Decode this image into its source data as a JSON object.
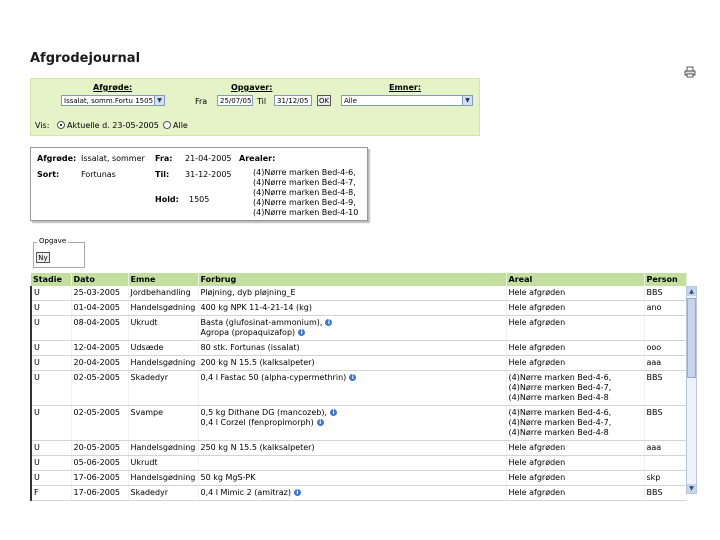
{
  "page": {
    "title": "Afgrodejournal"
  },
  "filter": {
    "afgrode_label": "Afgrøde:",
    "afgrode_value": "Issalat, somm.Fortu 1505",
    "opgaver_label": "Opgaver:",
    "fra_label": "Fra",
    "fra_value": "25/07/05",
    "til_label": "Til",
    "til_value": "31/12/05",
    "ok_label": "OK",
    "emner_label": "Emner:",
    "emner_value": "Alle",
    "vis_label": "Vis:",
    "vis_opt1": "Aktuelle d. 23-05-2005",
    "vis_opt2": "Alle"
  },
  "info": {
    "afgrode_label": "Afgrøde:",
    "afgrode_value": "Issalat, sommer",
    "fra_label": "Fra:",
    "fra_value": "21-04-2005",
    "areal_label": "Arealer:",
    "sort_label": "Sort:",
    "sort_value": "Fortunas",
    "til_label": "Til:",
    "til_value": "31-12-2005",
    "hold_label": "Hold:",
    "hold_value": "1505",
    "areas": [
      "(4)Nørre marken Bed-4-6,",
      "(4)Nørre marken Bed-4-7,",
      "(4)Nørre marken Bed-4-8,",
      "(4)Nørre marken Bed-4-9,",
      "(4)Nørre marken Bed-4-10"
    ]
  },
  "opgave": {
    "legend": "Opgave",
    "button": "Ny"
  },
  "table": {
    "headers": [
      "Stadie",
      "Dato",
      "Emne",
      "Forbrug",
      "Areal",
      "Person"
    ],
    "rows": [
      {
        "stadie": "U",
        "dato": "25-03-2005",
        "emne": "Jordbehandling",
        "forbrug": [
          "Pløjning, dyb pløjning_E"
        ],
        "areal": [
          "Hele afgrøden"
        ],
        "person": "BBS"
      },
      {
        "stadie": "U",
        "dato": "01-04-2005",
        "emne": "Handelsgødning",
        "forbrug": [
          "400 kg NPK 11-4-21-14 (kg)"
        ],
        "areal": [
          "Hele afgrøden"
        ],
        "person": "ano"
      },
      {
        "stadie": "U",
        "dato": "08-04-2005",
        "emne": "Ukrudt",
        "forbrug": [
          "Basta (glufosinat-ammonium),",
          "Agropa (propaquizafop)"
        ],
        "info": true,
        "areal": [
          "Hele afgrøden"
        ],
        "person": ""
      },
      {
        "stadie": "U",
        "dato": "12-04-2005",
        "emne": "Udsæde",
        "forbrug": [
          "80 stk. Fortunas (issalat)"
        ],
        "areal": [
          "Hele afgrøden"
        ],
        "person": "ooo"
      },
      {
        "stadie": "U",
        "dato": "20-04-2005",
        "emne": "Handelsgødning",
        "forbrug": [
          "200 kg N 15.5 (kalksalpeter)"
        ],
        "areal": [
          "Hele afgrøden"
        ],
        "person": "aaa"
      },
      {
        "stadie": "U",
        "dato": "02-05-2005",
        "emne": "Skadedyr",
        "forbrug": [
          "0,4 l Fastac 50 (alpha-cypermethrin)"
        ],
        "info": true,
        "areal": [
          "(4)Nørre marken Bed-4-6,",
          "(4)Nørre marken Bed-4-7,",
          "(4)Nørre marken Bed-4-8"
        ],
        "person": "BBS"
      },
      {
        "stadie": "U",
        "dato": "02-05-2005",
        "emne": "Svampe",
        "forbrug": [
          "0,5 kg Dithane DG (mancozeb),",
          "0,4 l Corzel (fenpropimorph)"
        ],
        "info": true,
        "areal": [
          "(4)Nørre marken Bed-4-6,",
          "(4)Nørre marken Bed-4-7,",
          "(4)Nørre marken Bed-4-8"
        ],
        "person": "BBS"
      },
      {
        "stadie": "U",
        "dato": "20-05-2005",
        "emne": "Handelsgødning",
        "forbrug": [
          "250 kg N 15.5 (kalksalpeter)"
        ],
        "areal": [
          "Hele afgrøden"
        ],
        "person": "aaa"
      },
      {
        "stadie": "U",
        "dato": "05-06-2005",
        "emne": "Ukrudt",
        "forbrug": [
          ""
        ],
        "areal": [
          "Hele afgrøden"
        ],
        "person": ""
      },
      {
        "stadie": "U",
        "dato": "17-06-2005",
        "emne": "Handelsgødning",
        "forbrug": [
          "50 kg MgS-PK"
        ],
        "areal": [
          "Hele afgrøden"
        ],
        "person": "skp"
      },
      {
        "stadie": "F",
        "dato": "17-06-2005",
        "emne": "Skadedyr",
        "forbrug": [
          "0,4 l Mimic 2 (amitraz)"
        ],
        "info": true,
        "areal": [
          "Hele afgrøden"
        ],
        "person": "BBS"
      }
    ]
  }
}
